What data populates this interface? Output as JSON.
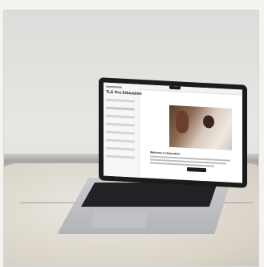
{
  "screen": {
    "course_title": "TLE Pro Education",
    "welcome_heading": "Welcome to Education"
  }
}
